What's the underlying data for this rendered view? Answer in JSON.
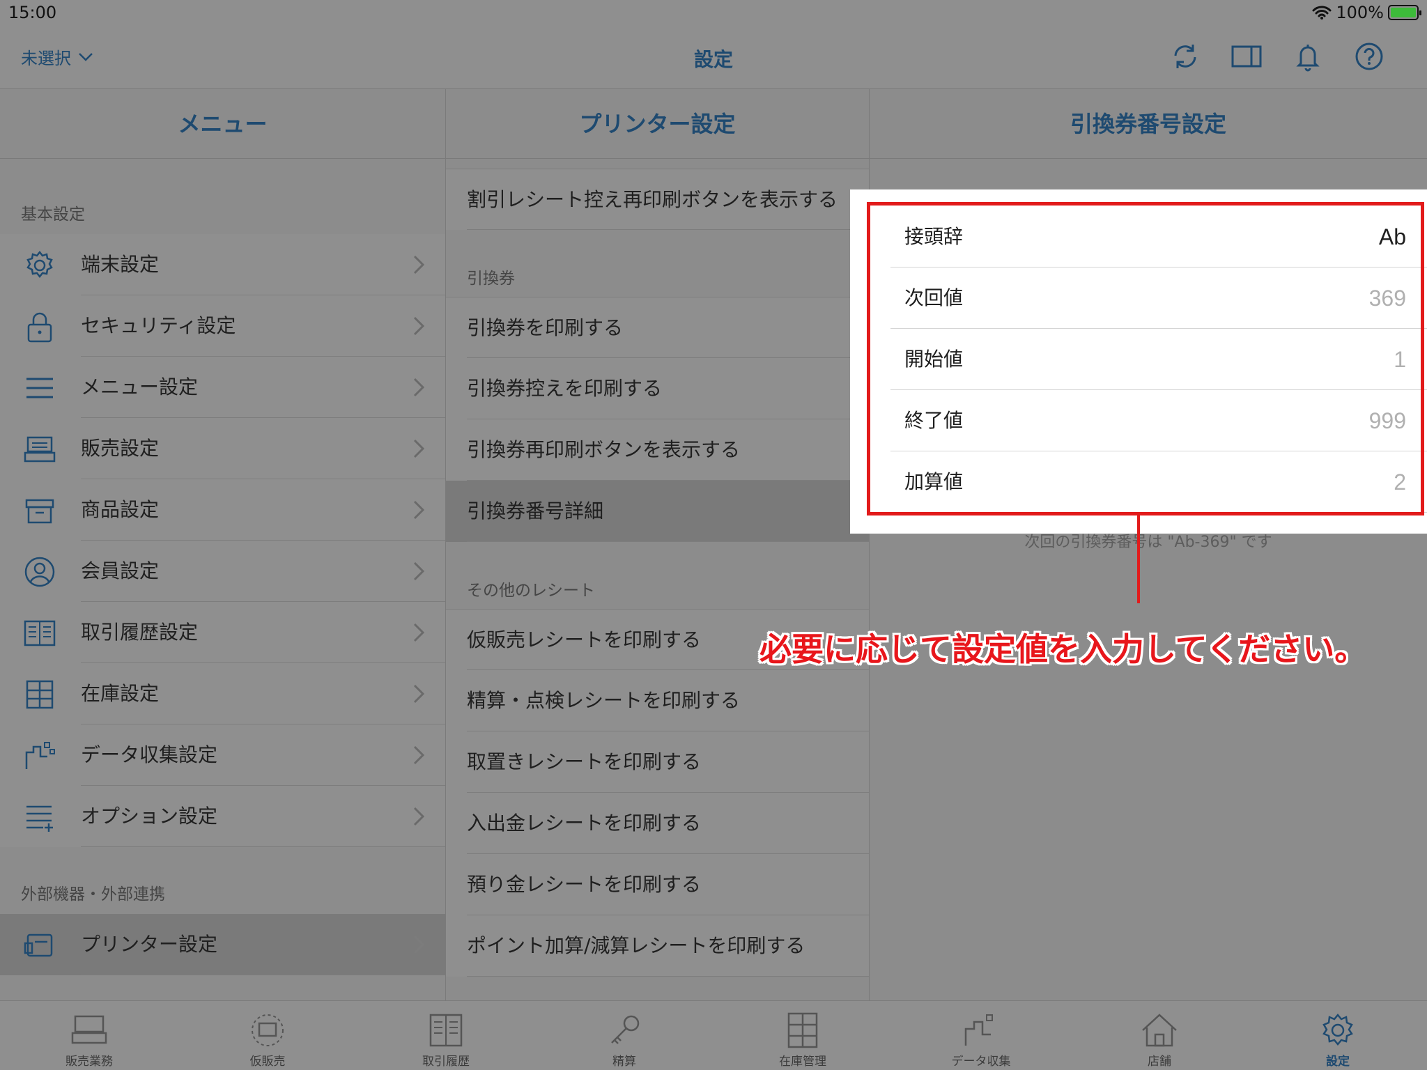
{
  "status": {
    "time": "15:00",
    "battery": "100%"
  },
  "nav": {
    "store": "未選択",
    "title": "設定",
    "icons": [
      "refresh-icon",
      "split-view-icon",
      "bell-icon",
      "help-icon"
    ]
  },
  "menu": {
    "header": "メニュー",
    "section1": "基本設定",
    "items": [
      {
        "label": "端末設定",
        "icon": "gear-icon"
      },
      {
        "label": "セキュリティ設定",
        "icon": "lock-icon"
      },
      {
        "label": "メニュー設定",
        "icon": "menu-icon"
      },
      {
        "label": "販売設定",
        "icon": "register-icon"
      },
      {
        "label": "商品設定",
        "icon": "box-icon"
      },
      {
        "label": "会員設定",
        "icon": "member-icon"
      },
      {
        "label": "取引履歴設定",
        "icon": "book-icon"
      },
      {
        "label": "在庫設定",
        "icon": "shelf-icon"
      },
      {
        "label": "データ収集設定",
        "icon": "data-icon"
      },
      {
        "label": "オプション設定",
        "icon": "option-icon"
      }
    ],
    "section2": "外部機器・外部連携",
    "selected": "プリンター設定"
  },
  "printer": {
    "header": "プリンター設定",
    "top_item": "割引レシート控え再印刷ボタンを表示する",
    "section_exchange": "引換券",
    "exchange_items": [
      "引換券を印刷する",
      "引換券控えを印刷する",
      "引換券再印刷ボタンを表示する",
      "引換券番号詳細"
    ],
    "section_other": "その他のレシート",
    "other_items": [
      "仮販売レシートを印刷する",
      "精算・点検レシートを印刷する",
      "取置きレシートを印刷する",
      "入出金レシートを印刷する",
      "預り金レシートを印刷する",
      "ポイント加算/減算レシートを印刷する"
    ]
  },
  "detail": {
    "header": "引換券番号設定",
    "fields": [
      {
        "label": "接頭辞",
        "value": "Ab"
      },
      {
        "label": "次回値",
        "value": "369"
      },
      {
        "label": "開始値",
        "value": "1"
      },
      {
        "label": "終了値",
        "value": "999"
      },
      {
        "label": "加算値",
        "value": "2"
      }
    ],
    "note": "次回の引換券番号は \"Ab-369\" です"
  },
  "callout": "必要に応じて設定値を入力してください。",
  "tabs": [
    {
      "label": "販売業務"
    },
    {
      "label": "仮販売"
    },
    {
      "label": "取引履歴"
    },
    {
      "label": "精算"
    },
    {
      "label": "在庫管理"
    },
    {
      "label": "データ収集"
    },
    {
      "label": "店舗"
    },
    {
      "label": "設定",
      "active": true
    }
  ],
  "colors": {
    "accent": "#1e4a70",
    "callout": "#e8161b"
  }
}
